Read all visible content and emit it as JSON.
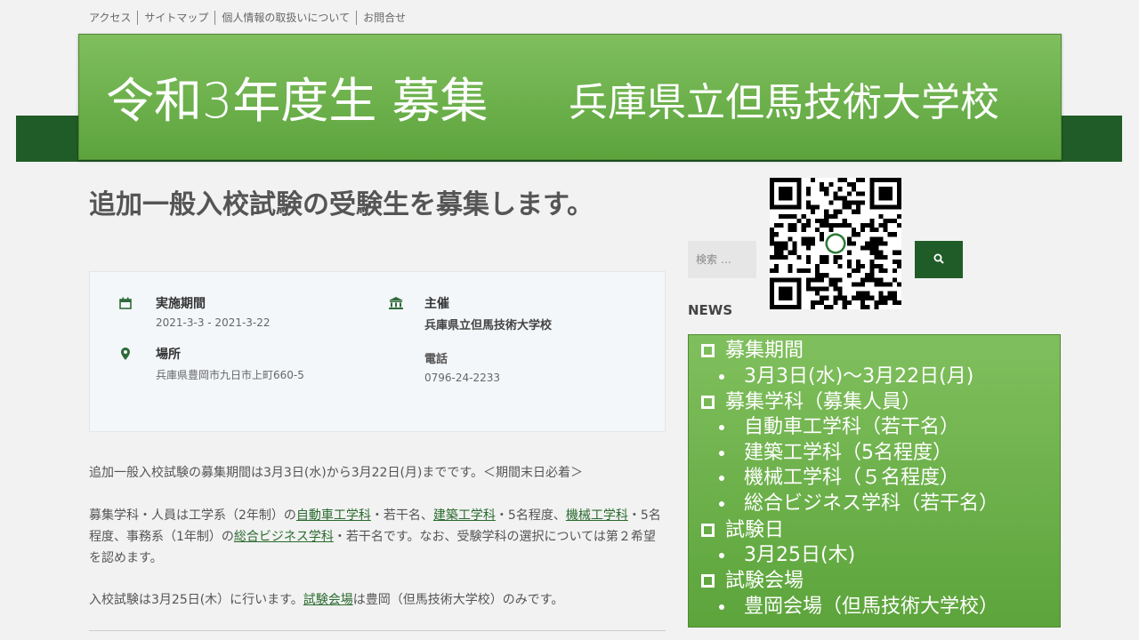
{
  "top_nav": [
    "アクセス",
    "サイトマップ",
    "個人情報の取扱いについて",
    "お問合せ"
  ],
  "banner": {
    "title": "令和3年度生 募集",
    "school": "兵庫県立但馬技術大学校"
  },
  "page_title": "追加一般入校試験の受験生を募集します。",
  "event": {
    "period_label": "実施期間",
    "period_value": "2021-3-3 - 2021-3-22",
    "place_label": "場所",
    "place_value": "兵庫県豊岡市九日市上町660-5",
    "organizer_label": "主催",
    "organizer_value": "兵庫県立但馬技術大学校",
    "phone_label": "電話",
    "phone_value": "0796-24-2233"
  },
  "body": {
    "p1": "追加一般入校試験の募集期間は3月3日(水)から3月22日(月)までです。＜期間末日必着＞",
    "p2a": "募集学科・人員は工学系（2年制）の",
    "p2_link1": "自動車工学科",
    "p2b": "・若干名、",
    "p2_link2": "建築工学科",
    "p2c": "・5名程度、",
    "p2_link3": "機械工学科",
    "p2d": "・5名程度、事務系（1年制）の",
    "p2_link4": "総合ビジネス学科",
    "p2e": "・若干名です。なお、受験学科の選択については第２希望を認めます。",
    "p3a": "入校試験は3月25日(木）に行います。",
    "p3_link": "試験会場",
    "p3b": "は豊岡（但馬技術大学校）のみです。"
  },
  "search": {
    "placeholder": "検索 …"
  },
  "news_heading": "NEWS",
  "green_box": {
    "h1": "募集期間",
    "i1": "3月3日(水)～3月22日(月)",
    "h2": "募集学科（募集人員）",
    "i2a": "自動車工学科（若干名）",
    "i2b": "建築工学科（5名程度）",
    "i2c": "機械工学科（５名程度）",
    "i2d": "総合ビジネス学科（若干名）",
    "h3": "試験日",
    "i3": "3月25日(木)",
    "h4": "試験会場",
    "i4": "豊岡会場（但馬技術大学校）"
  },
  "colors": {
    "dark_green": "#205c27",
    "banner_green": "#6cb24a",
    "link_green": "#2a6b2e"
  }
}
